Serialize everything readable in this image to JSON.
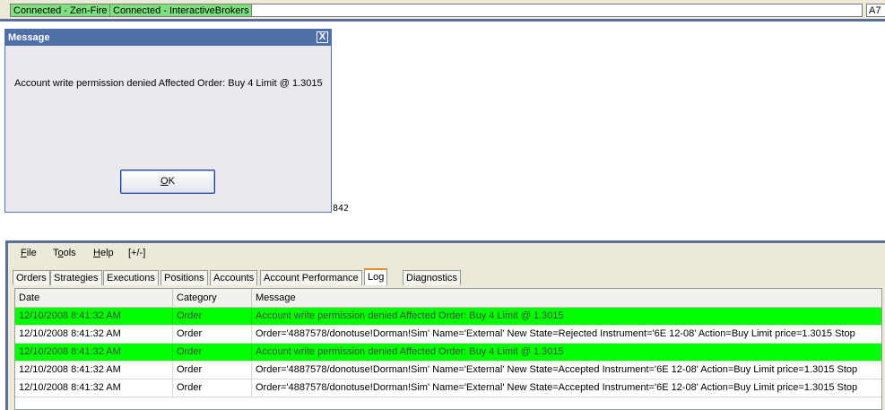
{
  "status_bar": {
    "items": [
      "Connected - Zen-Fire",
      "Connected - InteractiveBrokers"
    ],
    "right_text": "A7"
  },
  "dialog": {
    "title": "Message",
    "close_glyph": "X",
    "message": "Account write permission denied Affected Order: Buy 4 Limit @ 1.3015",
    "ok_label_mnemonic": "O",
    "ok_label_rest": "K"
  },
  "stray_text": "842",
  "menu": {
    "file": {
      "m": "F",
      "rest": "ile"
    },
    "tools": {
      "pre": "T",
      "m": "o",
      "rest": "ols"
    },
    "help": {
      "m": "H",
      "rest": "elp"
    },
    "toggle": "[+/-]"
  },
  "tabs": [
    "Orders",
    "Strategies",
    "Executions",
    "Positions",
    "Accounts",
    "Account Performance",
    "Log",
    "Diagnostics"
  ],
  "active_tab": "Log",
  "grid": {
    "headers": [
      "Date",
      "Category",
      "Message"
    ],
    "rows": [
      {
        "date": "12/10/2008 8:41:32 AM",
        "category": "Order",
        "message": "Account write permission denied Affected Order: Buy 4 Limit @ 1.3015",
        "highlight": true
      },
      {
        "date": "12/10/2008 8:41:32 AM",
        "category": "Order",
        "message": "Order='4887578/donotuse!Dorman!Sim' Name='External' New State=Rejected Instrument='6E 12-08' Action=Buy Limit price=1.3015 Stop",
        "highlight": false
      },
      {
        "date": "12/10/2008 8:41:32 AM",
        "category": "Order",
        "message": "Account write permission denied Affected Order: Buy 4 Limit @ 1.3015",
        "highlight": true
      },
      {
        "date": "12/10/2008 8:41:32 AM",
        "category": "Order",
        "message": "Order='4887578/donotuse!Dorman!Sim' Name='External' New State=Accepted Instrument='6E 12-08' Action=Buy Limit price=1.3015 Stop",
        "highlight": false
      },
      {
        "date": "12/10/2008 8:41:32 AM",
        "category": "Order",
        "message": "Order='4887578/donotuse!Dorman!Sim' Name='External' New State=Accepted Instrument='6E 12-08' Action=Buy Limit price=1.3015 Stop",
        "highlight": false
      }
    ]
  },
  "colors": {
    "highlight_row": "#00ff00",
    "status_connected": "#7fe07f",
    "title_bar": "#4f6fa8"
  }
}
